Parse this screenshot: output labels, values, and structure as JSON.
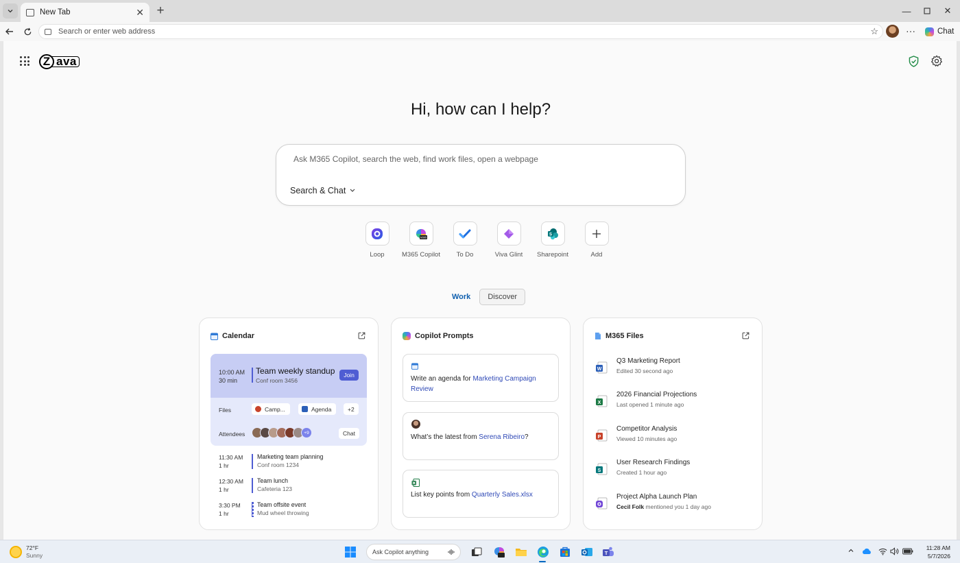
{
  "browser": {
    "tab_title": "New Tab",
    "address_placeholder": "Search or enter web address",
    "chat_label": "Chat"
  },
  "page": {
    "heading": "Hi, how can I help?",
    "search_placeholder": "Ask M365 Copilot, search the web, find work files, open a webpage",
    "search_mode": "Search & Chat",
    "logo_initial": "Z",
    "logo_rest": "ava",
    "quick_apps": [
      {
        "label": "Loop",
        "icon": "loop-icon"
      },
      {
        "label": "M365 Copilot",
        "icon": "m365-copilot-icon"
      },
      {
        "label": "To Do",
        "icon": "todo-icon"
      },
      {
        "label": "Viva Glint",
        "icon": "viva-glint-icon"
      },
      {
        "label": "Sharepoint",
        "icon": "sharepoint-icon"
      },
      {
        "label": "Add",
        "icon": "plus-icon"
      }
    ],
    "tabs": {
      "work": "Work",
      "discover": "Discover",
      "active": "Work"
    }
  },
  "calendar": {
    "title": "Calendar",
    "featured": {
      "time": "10:00 AM",
      "duration": "30 min",
      "title": "Team weekly standup",
      "room": "Conf room 3456",
      "join_label": "Join",
      "files_label": "Files",
      "files": [
        "Camp...",
        "Agenda"
      ],
      "files_more": "+2",
      "attendees_label": "Attendees",
      "attendees_more": "+9",
      "chat_label": "Chat"
    },
    "events": [
      {
        "time": "11:30 AM",
        "duration": "1 hr",
        "title": "Marketing team planning",
        "location": "Conf room 1234"
      },
      {
        "time": "12:30 AM",
        "duration": "1 hr",
        "title": "Team lunch",
        "location": "Cafeteria 123"
      },
      {
        "time": "3:30 PM",
        "duration": "1 hr",
        "title": "Team offsite event",
        "location": "Mud wheel throwing"
      }
    ]
  },
  "prompts": {
    "title": "Copilot Prompts",
    "items": [
      {
        "prefix": "Write an agenda for ",
        "highlight": "Marketing Campaign Review",
        "suffix": ""
      },
      {
        "prefix": "What’s the latest from ",
        "highlight": "Serena Ribeiro",
        "suffix": "?"
      },
      {
        "prefix": "List key points from ",
        "highlight": "Quarterly Sales.xlsx",
        "suffix": ""
      }
    ]
  },
  "files": {
    "title": "M365 Files",
    "items": [
      {
        "name": "Q3 Marketing Report",
        "meta": "Edited 30 second ago",
        "type": "word",
        "color": "#2b5fb8"
      },
      {
        "name": "2026 Financial Projections",
        "meta": "Last opened 1 minute ago",
        "type": "excel",
        "color": "#1d7a45"
      },
      {
        "name": "Competitor Analysis",
        "meta": "Viewed 10 minutes ago",
        "type": "powerpoint",
        "color": "#c8432b"
      },
      {
        "name": "User Research Findings",
        "meta": "Created 1 hour ago",
        "type": "sharepoint",
        "color": "#03787c"
      },
      {
        "name": "Project Alpha Launch Plan",
        "meta_bold": "Cecil Folk",
        "meta": " mentioned you 1 day ago",
        "type": "loop",
        "color": "#7145d6"
      }
    ]
  },
  "taskbar": {
    "temperature": "72°F",
    "condition": "Sunny",
    "search_placeholder": "Ask Copilot anything",
    "time": "11:28 AM",
    "date": "5/7/2026"
  }
}
